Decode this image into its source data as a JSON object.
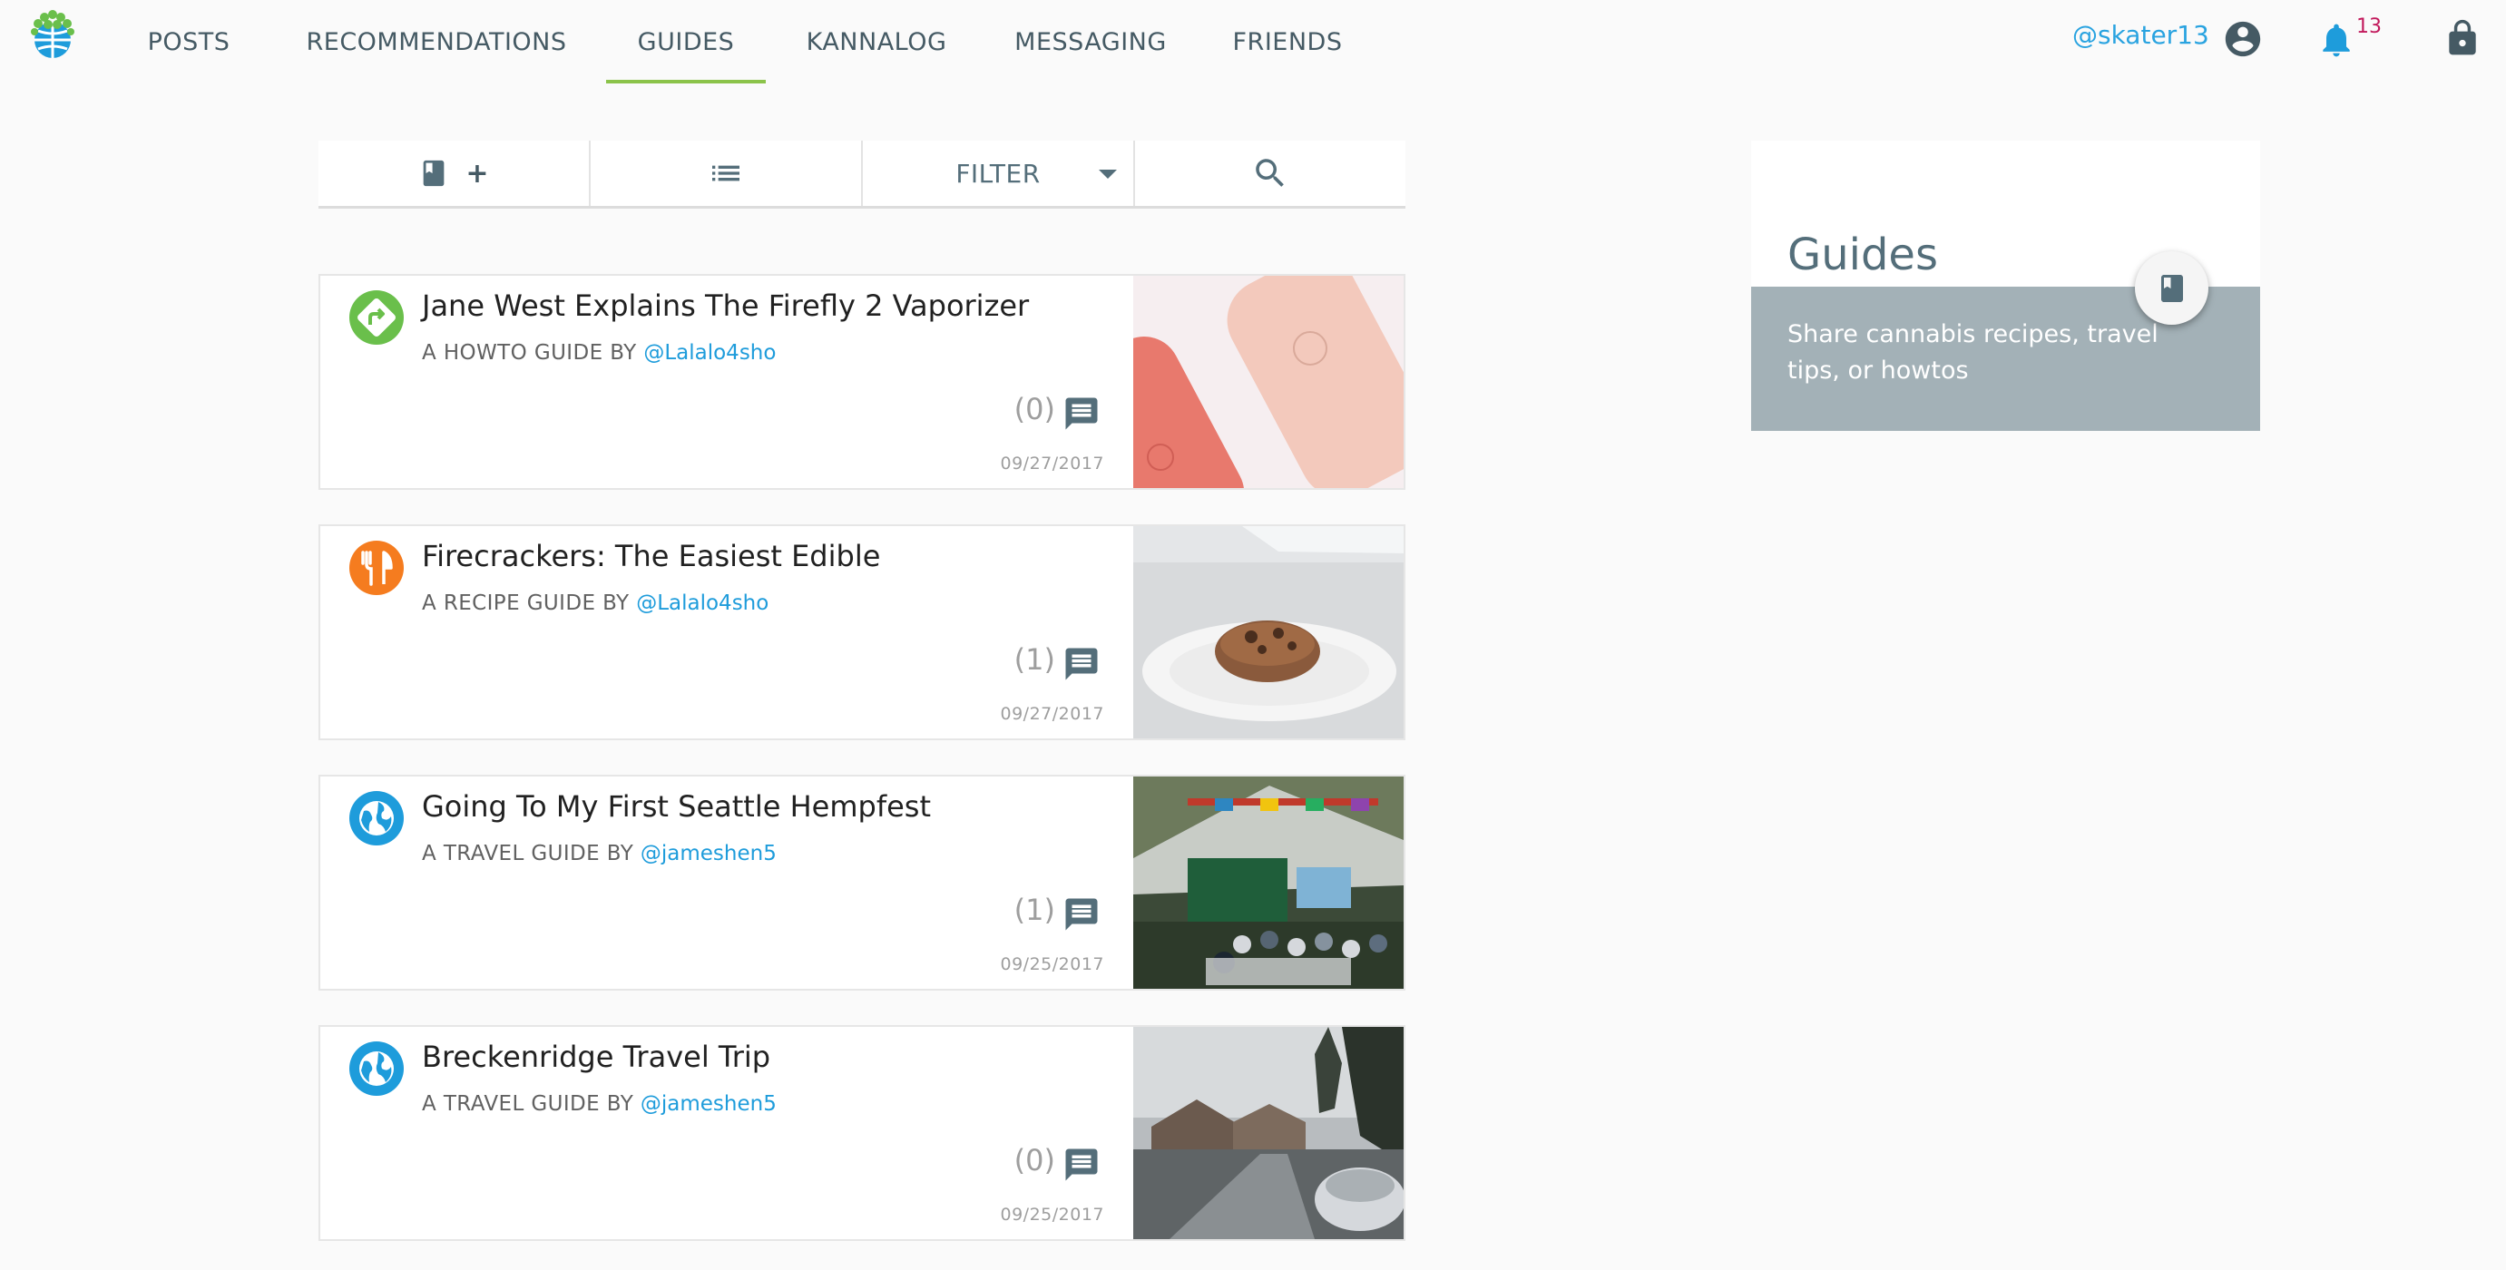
{
  "nav": {
    "items": [
      {
        "label": "POSTS",
        "active": false
      },
      {
        "label": "RECOMMENDATIONS",
        "active": false
      },
      {
        "label": "GUIDES",
        "active": true
      },
      {
        "label": "KANNALOG",
        "active": false
      },
      {
        "label": "MESSAGING",
        "active": false
      },
      {
        "label": "FRIENDS",
        "active": false
      }
    ],
    "username": "@skater13",
    "notification_count": "13",
    "icons": [
      "logo-globe-icon",
      "account-circle-icon",
      "bell-icon",
      "lock-icon"
    ]
  },
  "toolbar": {
    "add_guide_plus": "+",
    "filter_label": "FILTER",
    "icons": [
      "book-icon",
      "list-icon",
      "caret-down-icon",
      "search-icon"
    ]
  },
  "guides": [
    {
      "title": "Jane West Explains The Firefly 2 Vaporizer",
      "type_prefix": "A HOWTO GUIDE BY ",
      "author": "@Lalalo4sho",
      "comments": "(0)",
      "date": "09/27/2017",
      "icon": "directions-icon",
      "icon_color": "#6abf4b"
    },
    {
      "title": "Firecrackers: The Easiest Edible",
      "type_prefix": "A RECIPE GUIDE BY ",
      "author": "@Lalalo4sho",
      "comments": "(1)",
      "date": "09/27/2017",
      "icon": "restaurant-icon",
      "icon_color": "#f57c1f"
    },
    {
      "title": "Going To My First Seattle Hempfest",
      "type_prefix": "A TRAVEL GUIDE BY ",
      "author": "@jameshen5",
      "comments": "(1)",
      "date": "09/25/2017",
      "icon": "globe-icon",
      "icon_color": "#1e9cdb"
    },
    {
      "title": "Breckenridge Travel Trip",
      "type_prefix": "A TRAVEL GUIDE BY ",
      "author": "@jameshen5",
      "comments": "(0)",
      "date": "09/25/2017",
      "icon": "globe-icon",
      "icon_color": "#1e9cdb"
    }
  ],
  "sidebar": {
    "title": "Guides",
    "description": "Share cannabis recipes, travel tips, or howtos"
  },
  "colors": {
    "accent_green": "#8bc34a",
    "link_blue": "#1e9cdb",
    "notification_red": "#c2185b",
    "icon_slate": "#455a64"
  }
}
